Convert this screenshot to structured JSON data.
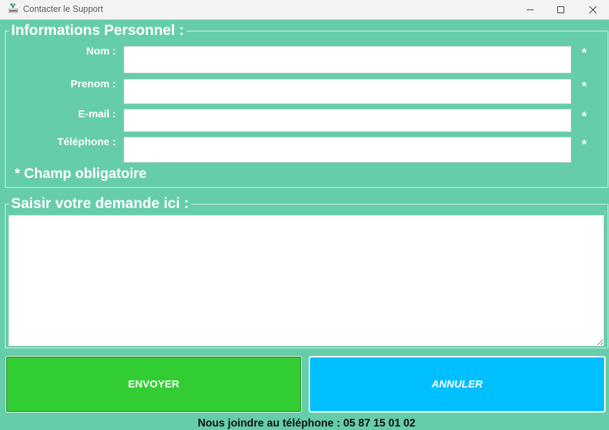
{
  "window": {
    "title": "Contacter le Support",
    "icon": "app-logo-icon",
    "controls": [
      "minimize-icon",
      "maximize-icon",
      "close-icon"
    ]
  },
  "personal_info": {
    "legend": "Informations Personnel :",
    "fields": [
      {
        "label": "Nom :",
        "value": "",
        "required_mark": "*"
      },
      {
        "label": "Prenom :",
        "value": "",
        "required_mark": "*"
      },
      {
        "label": "E-mail :",
        "value": "",
        "required_mark": "*"
      },
      {
        "label": "Téléphone :",
        "value": "",
        "required_mark": "*"
      }
    ],
    "required_note": "* Champ obligatoire"
  },
  "request": {
    "legend": "Saisir votre demande ici  :",
    "value": ""
  },
  "actions": {
    "send_label": "ENVOYER",
    "cancel_label": "ANNULER"
  },
  "footer": {
    "text": "Nous joindre au téléphone : 05 87 15 01 02"
  },
  "colors": {
    "background": "#66cdaa",
    "send": "#32cd32",
    "cancel": "#00bfff"
  }
}
